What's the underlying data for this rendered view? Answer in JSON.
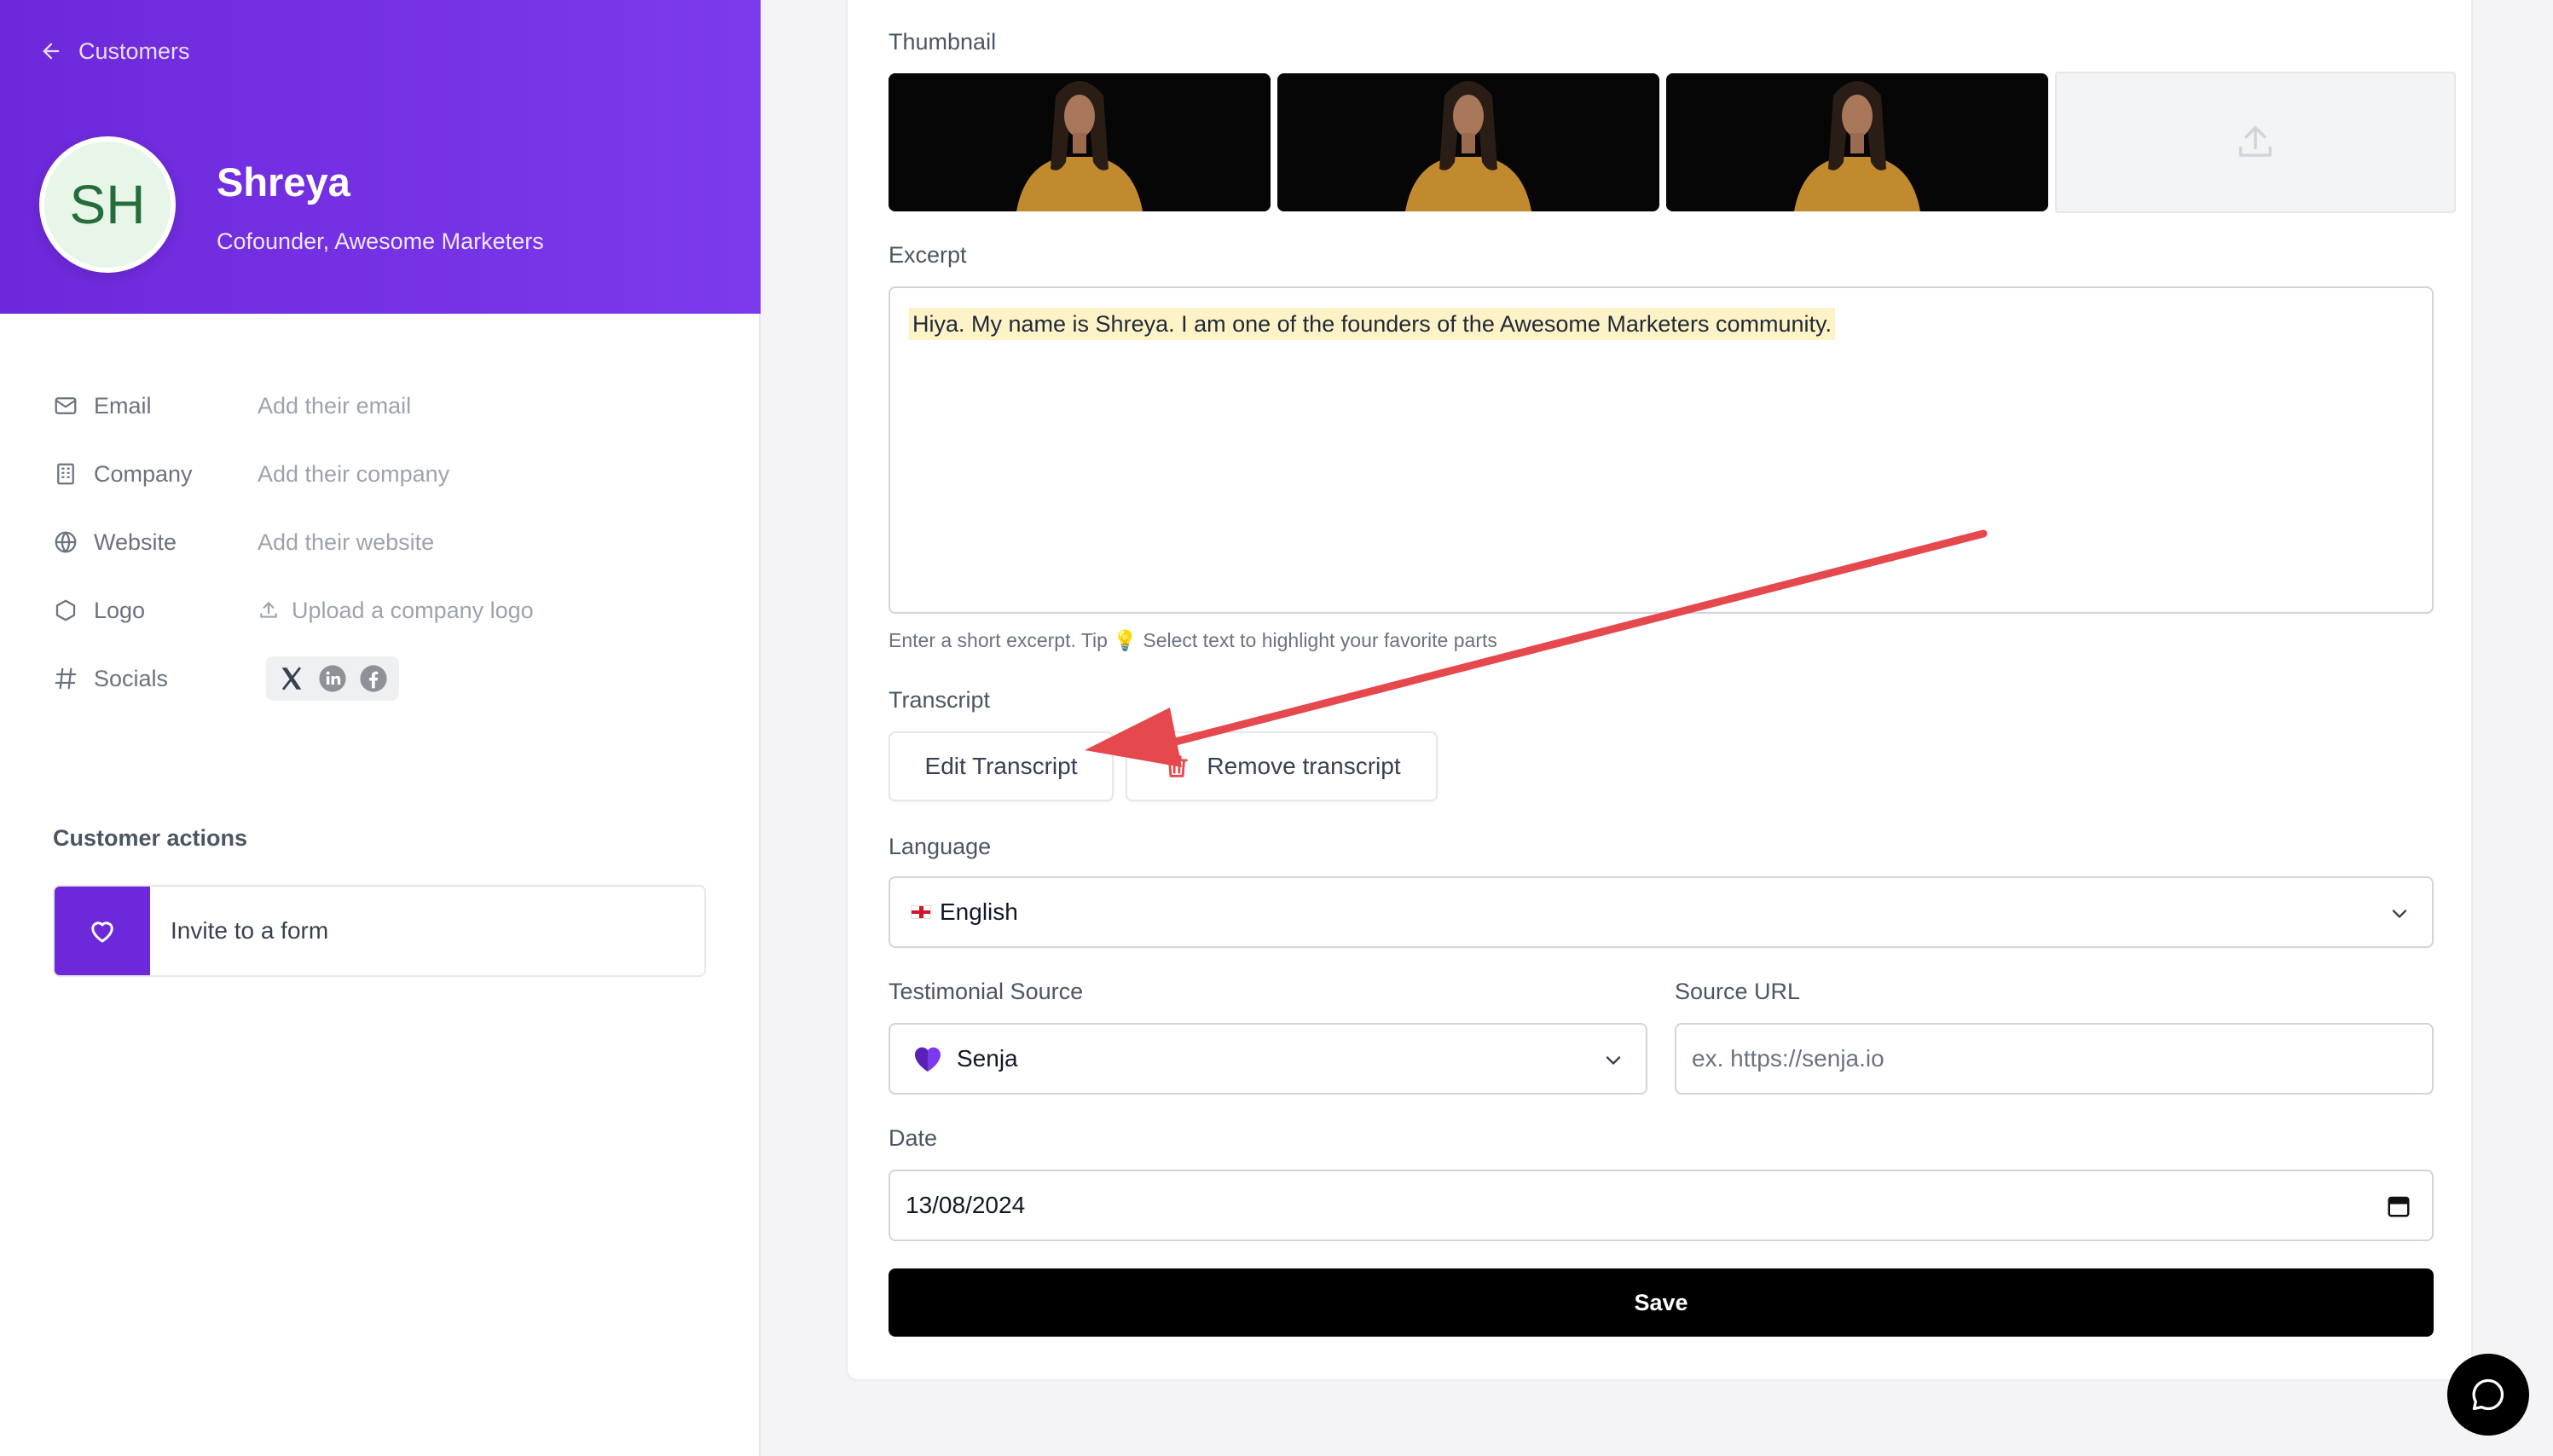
{
  "nav": {
    "back_label": "Customers"
  },
  "profile": {
    "initials": "SH",
    "name": "Shreya",
    "title": "Cofounder, Awesome Marketers"
  },
  "fields": [
    {
      "label": "Email",
      "value": "Add their email",
      "icon": "mail-icon"
    },
    {
      "label": "Company",
      "value": "Add their company",
      "icon": "building-icon"
    },
    {
      "label": "Website",
      "value": "Add their website",
      "icon": "globe-icon"
    },
    {
      "label": "Logo",
      "value": "Upload a company logo",
      "icon": "hexagon-icon"
    },
    {
      "label": "Socials",
      "icon": "hash-icon"
    }
  ],
  "customer_actions": {
    "title": "Customer actions",
    "invite_label": "Invite to a form"
  },
  "form": {
    "thumbnail_label": "Thumbnail",
    "excerpt_label": "Excerpt",
    "excerpt_text": "Hiya. My name is Shreya. I am one of the founders of the Awesome Marketers community.",
    "excerpt_hint": "Enter a short excerpt. Tip 💡 Select text to highlight your favorite parts",
    "transcript_label": "Transcript",
    "edit_transcript": "Edit Transcript",
    "remove_transcript": "Remove transcript",
    "language_label": "Language",
    "language_value": "English",
    "source_label": "Testimonial Source",
    "source_value": "Senja",
    "source_url_label": "Source URL",
    "source_url_placeholder": "ex. https://senja.io",
    "date_label": "Date",
    "date_value": "13/08/2024",
    "save_label": "Save"
  },
  "colors": {
    "brand": "#6d28d9",
    "annotation_arrow": "#e5484d",
    "highlight": "#fef3c7"
  }
}
